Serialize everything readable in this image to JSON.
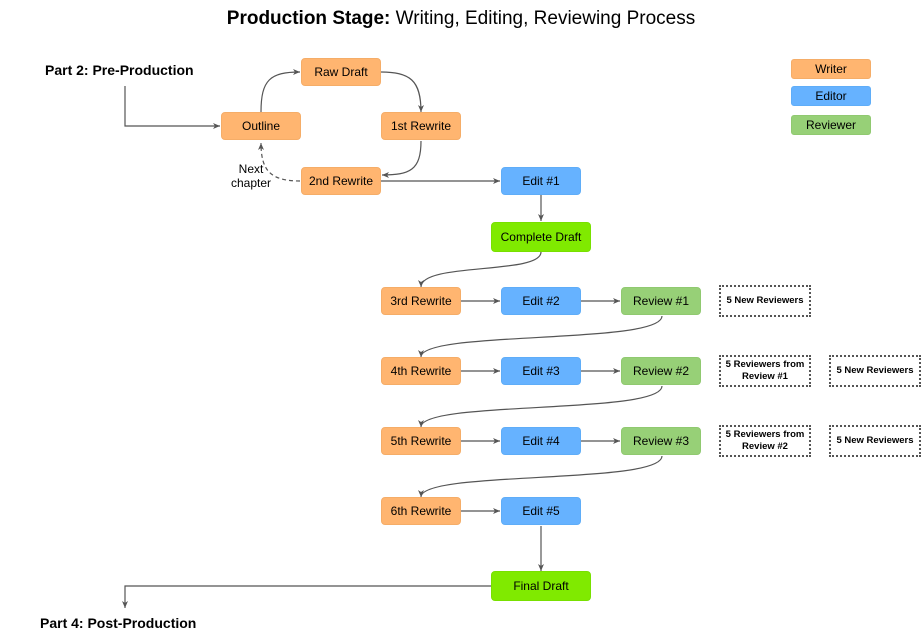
{
  "title": {
    "bold": "Production Stage:",
    "rest": " Writing, Editing, Reviewing Process"
  },
  "parts": {
    "start": "Part 2: Pre-Production",
    "end": "Part 4: Post-Production"
  },
  "legend": [
    {
      "label": "Writer",
      "color": "#ffb570"
    },
    {
      "label": "Editor",
      "color": "#66b2ff"
    },
    {
      "label": "Reviewer",
      "color": "#97d077"
    }
  ],
  "loop_label": "Next\nchapter",
  "nodes": {
    "raw_draft": "Raw Draft",
    "outline": "Outline",
    "rewrite_1": "1st Rewrite",
    "rewrite_2": "2nd Rewrite",
    "edit_1": "Edit #1",
    "complete_draft": "Complete Draft",
    "rewrite_3": "3rd Rewrite",
    "edit_2": "Edit #2",
    "review_1": "Review #1",
    "rewrite_4": "4th Rewrite",
    "edit_3": "Edit #3",
    "review_2": "Review #2",
    "rewrite_5": "5th Rewrite",
    "edit_4": "Edit #4",
    "review_3": "Review #3",
    "rewrite_6": "6th Rewrite",
    "edit_5": "Edit #5",
    "final_draft": "Final Draft"
  },
  "notes": {
    "review_1_a": "5 New Reviewers",
    "review_2_a": "5 Reviewers from Review #1",
    "review_2_b": "5 New Reviewers",
    "review_3_a": "5 Reviewers from Review #2",
    "review_3_b": "5 New Reviewers"
  }
}
